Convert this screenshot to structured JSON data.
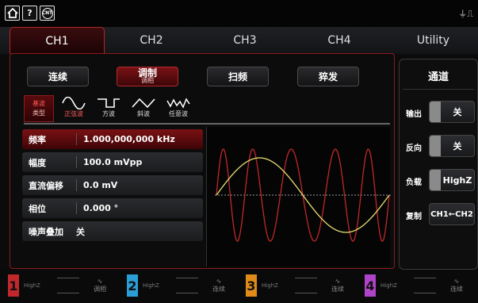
{
  "topbar": {
    "icons": [
      "home-icon",
      "help-icon",
      "counter-icon"
    ],
    "counter_label": "CNT",
    "usb_glyph": "⏚⎍"
  },
  "tabs": [
    {
      "label": "CH1",
      "active": true
    },
    {
      "label": "CH2",
      "active": false
    },
    {
      "label": "CH3",
      "active": false
    },
    {
      "label": "CH4",
      "active": false
    },
    {
      "label": "Utility",
      "active": false
    }
  ],
  "modes": [
    {
      "label": "连续",
      "sub": ""
    },
    {
      "label": "调制",
      "sub": "调相"
    },
    {
      "label": "扫频",
      "sub": ""
    },
    {
      "label": "猝发",
      "sub": ""
    }
  ],
  "wave_type": {
    "line1": "基波",
    "line2": "类型"
  },
  "waves": [
    {
      "label": "正弦波",
      "icon": "sine-wave-icon"
    },
    {
      "label": "方波",
      "icon": "square-wave-icon"
    },
    {
      "label": "斜波",
      "icon": "ramp-wave-icon"
    },
    {
      "label": "任意波",
      "icon": "arbitrary-wave-icon"
    }
  ],
  "params": [
    {
      "label": "频率",
      "value": "1.000,000,000 kHz",
      "active": true
    },
    {
      "label": "幅度",
      "value": "100.0 mVpp",
      "active": false
    },
    {
      "label": "直流偏移",
      "value": "0.0 mV",
      "active": false
    },
    {
      "label": "相位",
      "value": "0.000 °",
      "active": false
    },
    {
      "label": "噪声叠加",
      "value": "关",
      "active": false
    }
  ],
  "right_panel": {
    "title": "通道",
    "rows": [
      {
        "label": "输出",
        "value": "关",
        "toggle": true
      },
      {
        "label": "反向",
        "value": "关",
        "toggle": true
      },
      {
        "label": "负载",
        "value": "HighZ",
        "toggle": true
      },
      {
        "label": "复制",
        "value": "CH1←CH2",
        "toggle": false
      }
    ]
  },
  "bottom_channels": [
    {
      "num": "1",
      "load": "HighZ",
      "mode": "调相",
      "color": "#c0282c"
    },
    {
      "num": "2",
      "load": "HighZ",
      "mode": "连续",
      "color": "#2a9fd6"
    },
    {
      "num": "3",
      "load": "HighZ",
      "mode": "连续",
      "color": "#e08a1a"
    },
    {
      "num": "4",
      "load": "HighZ",
      "mode": "连续",
      "color": "#b044c8"
    }
  ],
  "colors": {
    "accent": "#b3262a",
    "carrier_wave": "#c0282c",
    "modulating_wave": "#e8e070",
    "center_line": "#9a9a9a"
  }
}
